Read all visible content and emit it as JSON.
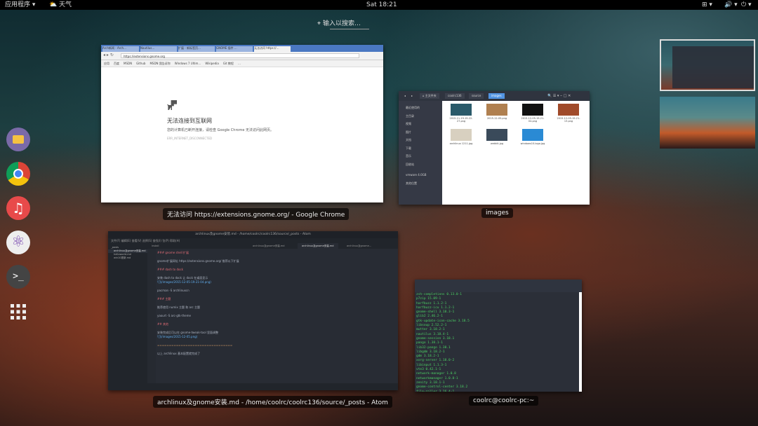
{
  "topbar": {
    "apps_menu": "应用程序 ▾",
    "weather": "天气",
    "clock": "Sat 18:21",
    "tray": [
      "⊞ ▾",
      "🔊 ▾",
      "⏻ ▾"
    ]
  },
  "search": {
    "placeholder": "输入以搜索…"
  },
  "dock": {
    "items": [
      "files-icon",
      "chrome-icon",
      "music-icon",
      "atom-icon",
      "terminal-icon",
      "app-grid-icon"
    ]
  },
  "chrome_window": {
    "caption": "无法访问 https://extensions.gnome.org/ - Google Chrome",
    "tabs": [
      "Arch新闻 - Arch…",
      "Nautilus…",
      "扩展 - 新标签页…",
      "GNOME 插件 …",
      "无法访问 https://…"
    ],
    "url": "https://extensions.gnome.org",
    "bookmarks": [
      "应用",
      "百度",
      "MSDN",
      "Github",
      "MSDN 我告诉你",
      "Windows 7 Ultim…",
      "Wikipedia",
      "Git 教程",
      "…"
    ],
    "error_title": "无法连接到互联网",
    "error_sub": "您的计算机已断开连接，请检查 Google Chrome 无法访问此网页。",
    "error_code": "ERR_INTERNET_DISCONNECTED"
  },
  "files_window": {
    "caption": "images",
    "path": [
      "◂",
      "▸",
      "⌂ 主文件夹",
      "coolrc136",
      "source",
      "images"
    ],
    "sidebar": [
      "最近使用的",
      "主目录",
      "视频",
      "图片",
      "文档",
      "下载",
      "音乐",
      "回收站",
      "vmware 4.0GB",
      "其他位置"
    ],
    "files": [
      {
        "name": "2015-11-19-19-22-27.png",
        "color": "#2a5a6a"
      },
      {
        "name": "2015-12-05.png",
        "color": "#b08050"
      },
      {
        "name": "2015-12-05-19-21-04.png",
        "color": "#111111"
      },
      {
        "name": "2015-12-05-19-21-13.png",
        "color": "#a04a2a"
      },
      {
        "name": "archlinux 1211.jpg",
        "color": "#d8d0c0"
      },
      {
        "name": "webkit.jpg",
        "color": "#3a4a5a"
      },
      {
        "name": "windows10-logo.jpg",
        "color": "#2a8ad4"
      }
    ]
  },
  "atom_window": {
    "caption": "archlinux及gnome安装.md - /home/coolrc/coolrc136/source/_posts - Atom",
    "title": "archlinux及gnome安装.md - /home/coolrc/coolrc136/source/_posts - Atom",
    "menu": "文件(F)  编辑(E)  查看(V)  选择(S)  查找(I)  包(P)  帮助(H)",
    "tabs": [
      "install",
      "archlinux及gnome安装.md",
      "archlinux及gnome安装.md",
      "archlinux及gnome…"
    ],
    "tree": [
      "_posts",
      "archlinux及gnome安装.md",
      "helloworld.md",
      "win10更新.md"
    ],
    "code": [
      "### gnome shell 扩展",
      "",
      "gnome扩展网址 https://extensions.gnome.org/ 推荐以下扩展",
      "",
      "### dash to dock",
      "",
      "安装 dash to dock 让 dock 在桌面显示",
      "![](/images/2015-12-05-19-21-04.png)",
      "",
      "     pacman -S archlinuxcn",
      "",
      "### 主题",
      "",
      "推荐使用 numix 主题 和 arc 主题",
      "",
      "     yaourt -S arc-gtk-theme",
      "",
      "## 其他",
      "",
      "安装完成后可以在 gnome-tweak-tool 里面调整",
      "![](/images/2015-12-05.png)",
      "",
      "================================",
      "",
      "以上 archlinux 基本配置就完成了"
    ]
  },
  "terminal_window": {
    "caption": "coolrc@coolrc-pc:~",
    "lines": [
      "zsh-completions 0.13.0-1",
      "p7zip 15.09-1",
      "harfbuzz 1.1.2-1",
      "harfbuzz-icu 1.1.2-1",
      "gnome-shell 3.18.3-1",
      "glib2 2.46.2-1",
      "gtk-update-icon-cache 3.18.5",
      "libsoup 2.52.2-1",
      "mutter 3.18.2-1",
      "nautilus 3.18.4-1",
      "gnome-session 3.18.1",
      "pango 1.38.1-1",
      "lib32-pango 1.38.1",
      "libgdm 3.18.2-1",
      "gdm 3.18.2-1",
      "xorg-server 1.18.0-2",
      "libinput 1.1.3-1",
      "vte3 0.42.1-1",
      "network-manager 1.0.8",
      "networkmanager 1.0.8-1",
      "zenity 3.18.1-1",
      "gnome-control-center 3.18.2",
      "file-roller 3.16.4-1",
      "eog 3.18.1-1"
    ]
  }
}
